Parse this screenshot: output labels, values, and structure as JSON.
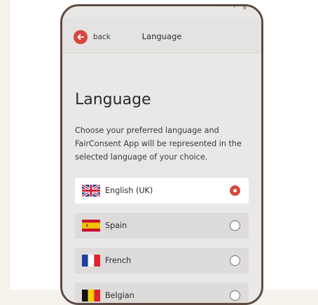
{
  "header": {
    "back_label": "back",
    "title": "Language"
  },
  "main": {
    "title": "Language",
    "description": "Choose your preferred language and FairConsent App will be represented in the selected language of your choice."
  },
  "languages": [
    {
      "label": "English (UK)",
      "flag": "uk-flag-icon",
      "selected": true
    },
    {
      "label": "Spain",
      "flag": "spain-flag-icon",
      "selected": false
    },
    {
      "label": "French",
      "flag": "france-flag-icon",
      "selected": false
    },
    {
      "label": "Belgian",
      "flag": "belgium-flag-icon",
      "selected": false
    }
  ],
  "colors": {
    "accent": "#d7473e",
    "phone_frame": "#5f4a44",
    "screen_bg": "#e9e8e6",
    "item_bg": "#dedcda",
    "selected_bg": "#ffffff"
  }
}
